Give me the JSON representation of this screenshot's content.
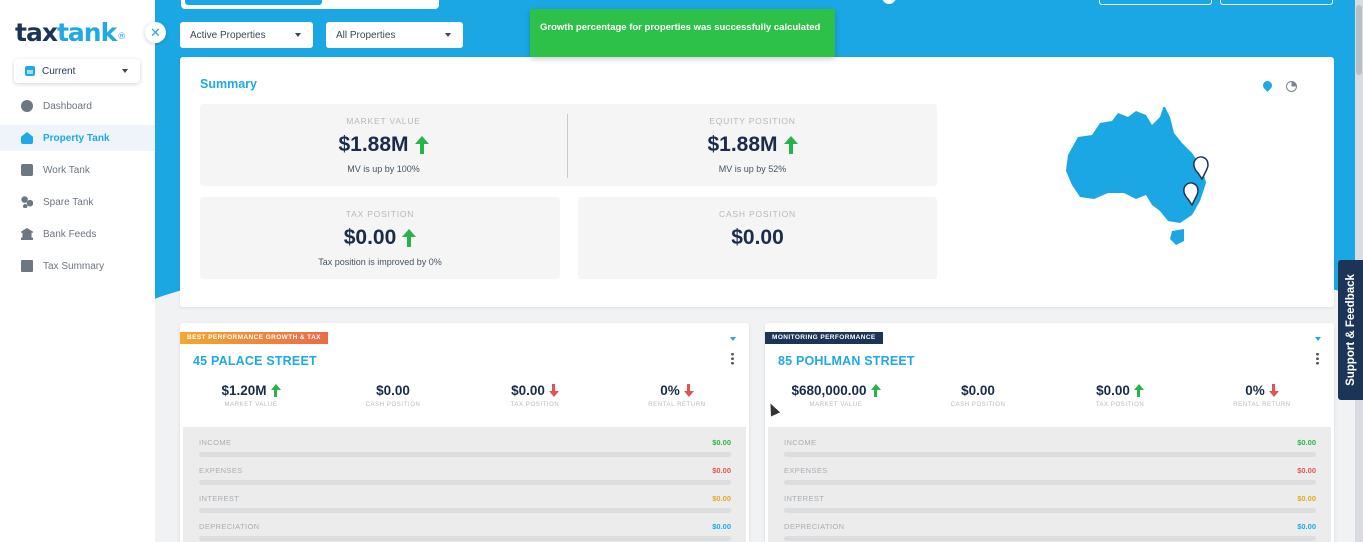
{
  "app": {
    "logo_part1": "tax",
    "logo_part2": "tank",
    "logo_mark": "®"
  },
  "sidebar": {
    "close_label": "✕",
    "year_select": "Current",
    "items": [
      {
        "label": "Dashboard",
        "icon": "dashboard-icon",
        "active": false
      },
      {
        "label": "Property Tank",
        "icon": "property-tank-icon",
        "active": true
      },
      {
        "label": "Work Tank",
        "icon": "work-tank-icon",
        "active": false
      },
      {
        "label": "Spare Tank",
        "icon": "spare-tank-icon",
        "active": false
      },
      {
        "label": "Bank Feeds",
        "icon": "bank-feeds-icon",
        "active": false
      },
      {
        "label": "Tax Summary",
        "icon": "tax-summary-icon",
        "active": false
      }
    ]
  },
  "filters": {
    "status": "Active Properties",
    "scope": "All Properties"
  },
  "toast": {
    "message": "Growth percentage for properties was successfully calculated"
  },
  "summary": {
    "title": "Summary",
    "market_value": {
      "label": "MARKET VALUE",
      "value": "$1.88M",
      "note": "MV is up by 100%"
    },
    "equity_position": {
      "label": "EQUITY POSITION",
      "value": "$1.88M",
      "note": "MV is up by 52%"
    },
    "tax_position": {
      "label": "TAX POSITION",
      "value": "$0.00",
      "note": "Tax position is improved by 0%"
    },
    "cash_position": {
      "label": "CASH POSITION",
      "value": "$0.00"
    }
  },
  "properties": [
    {
      "tag": "BEST PERFORMANCE GROWTH & TAX",
      "name": "45 PALACE STREET",
      "metrics": [
        {
          "value": "$1.20M",
          "label": "MARKET VALUE",
          "trend": "up"
        },
        {
          "value": "$0.00",
          "label": "CASH POSITION",
          "trend": "none"
        },
        {
          "value": "$0.00",
          "label": "TAX POSITION",
          "trend": "down"
        },
        {
          "value": "0%",
          "label": "RENTAL RETURN",
          "trend": "down"
        }
      ],
      "rows": [
        {
          "label": "INCOME",
          "value": "$0.00",
          "color": "#2fb34a"
        },
        {
          "label": "EXPENSES",
          "value": "$0.00",
          "color": "#e0554f"
        },
        {
          "label": "INTEREST",
          "value": "$0.00",
          "color": "#e5a91e"
        },
        {
          "label": "DEPRECIATION",
          "value": "$0.00",
          "color": "#1fa9e6"
        }
      ]
    },
    {
      "tag": "MONITORING PERFORMANCE",
      "name": "85 POHLMAN STREET",
      "metrics": [
        {
          "value": "$680,000.00",
          "label": "MARKET VALUE",
          "trend": "up"
        },
        {
          "value": "$0.00",
          "label": "CASH POSITION",
          "trend": "none"
        },
        {
          "value": "$0.00",
          "label": "TAX POSITION",
          "trend": "up"
        },
        {
          "value": "0%",
          "label": "RENTAL RETURN",
          "trend": "down"
        }
      ],
      "rows": [
        {
          "label": "INCOME",
          "value": "$0.00",
          "color": "#2fb34a"
        },
        {
          "label": "EXPENSES",
          "value": "$0.00",
          "color": "#e0554f"
        },
        {
          "label": "INTEREST",
          "value": "$0.00",
          "color": "#e5a91e"
        },
        {
          "label": "DEPRECIATION",
          "value": "$0.00",
          "color": "#1fa9e6"
        }
      ]
    }
  ],
  "support": {
    "label": "Support & Feedback"
  },
  "colors": {
    "brand_blue": "#1ba7e4",
    "navy": "#1c3556",
    "success_green": "#2dc149"
  }
}
